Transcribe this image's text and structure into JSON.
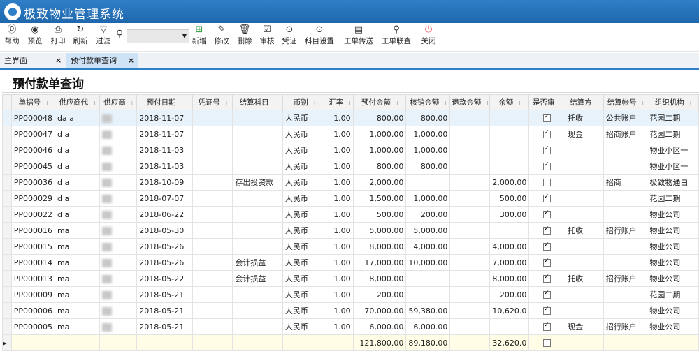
{
  "app": {
    "title": "极致物业管理系统"
  },
  "toolbar": {
    "help": "帮助",
    "preview": "预览",
    "print": "打印",
    "refresh": "刷新",
    "filter": "过滤",
    "add": "新增",
    "edit": "修改",
    "delete": "删除",
    "audit": "审核",
    "voucher": "凭证",
    "subject_setting": "科目设置",
    "workflow_transfer": "工单传送",
    "workflow_query": "工单联查",
    "close": "关闭"
  },
  "tabs": [
    {
      "label": "主界面"
    },
    {
      "label": "预付款单查询"
    }
  ],
  "panel": {
    "title": "预付款单查询"
  },
  "columns": [
    "单据号",
    "供应商代",
    "供应商",
    "预付日期",
    "凭证号",
    "结算科目",
    "币别",
    "汇率",
    "预付金额",
    "核销金额",
    "退款金额",
    "余额",
    "是否审",
    "结算方",
    "结算帐号",
    "组织机构"
  ],
  "rows": [
    {
      "no": "PP000048",
      "code": "da  a",
      "date": "2018-11-07",
      "voucher": "",
      "subject": "",
      "currency": "人民币",
      "rate": "1.00",
      "amount": "800.00",
      "verified": "800.00",
      "refund": "",
      "balance": "",
      "audited": true,
      "method": "托收",
      "account": "公共账户",
      "org": "花园二期"
    },
    {
      "no": "PP000047",
      "code": "d  a",
      "date": "2018-11-07",
      "voucher": "",
      "subject": "",
      "currency": "人民币",
      "rate": "1.00",
      "amount": "1,000.00",
      "verified": "1,000.00",
      "refund": "",
      "balance": "",
      "audited": true,
      "method": "现金",
      "account": "招商账户",
      "org": "花园二期"
    },
    {
      "no": "PP000046",
      "code": "d  a",
      "date": "2018-11-03",
      "voucher": "",
      "subject": "",
      "currency": "人民币",
      "rate": "1.00",
      "amount": "1,000.00",
      "verified": "1,000.00",
      "refund": "",
      "balance": "",
      "audited": true,
      "method": "",
      "account": "",
      "org": "物业小区一"
    },
    {
      "no": "PP000045",
      "code": "d  a",
      "date": "2018-11-03",
      "voucher": "",
      "subject": "",
      "currency": "人民币",
      "rate": "1.00",
      "amount": "800.00",
      "verified": "800.00",
      "refund": "",
      "balance": "",
      "audited": true,
      "method": "",
      "account": "",
      "org": "物业小区一"
    },
    {
      "no": "PP000036",
      "code": "d  a",
      "date": "2018-10-09",
      "voucher": "",
      "subject": "存出投资款",
      "currency": "人民币",
      "rate": "1.00",
      "amount": "2,000.00",
      "verified": "",
      "refund": "",
      "balance": "2,000.00",
      "audited": false,
      "method": "",
      "account": "招商",
      "org": "极致物通白"
    },
    {
      "no": "PP000029",
      "code": "d  a",
      "date": "2018-07-07",
      "voucher": "",
      "subject": "",
      "currency": "人民币",
      "rate": "1.00",
      "amount": "1,500.00",
      "verified": "1,000.00",
      "refund": "",
      "balance": "500.00",
      "audited": true,
      "method": "",
      "account": "",
      "org": "花园二期"
    },
    {
      "no": "PP000022",
      "code": "d  a",
      "date": "2018-06-22",
      "voucher": "",
      "subject": "",
      "currency": "人民币",
      "rate": "1.00",
      "amount": "500.00",
      "verified": "200.00",
      "refund": "",
      "balance": "300.00",
      "audited": true,
      "method": "",
      "account": "",
      "org": "物业公司"
    },
    {
      "no": "PP000016",
      "code": "ma",
      "date": "2018-05-30",
      "voucher": "",
      "subject": "",
      "currency": "人民币",
      "rate": "1.00",
      "amount": "5,000.00",
      "verified": "5,000.00",
      "refund": "",
      "balance": "",
      "audited": true,
      "method": "托收",
      "account": "招行账户",
      "org": "物业公司"
    },
    {
      "no": "PP000015",
      "code": "ma",
      "date": "2018-05-26",
      "voucher": "",
      "subject": "",
      "currency": "人民币",
      "rate": "1.00",
      "amount": "8,000.00",
      "verified": "4,000.00",
      "refund": "",
      "balance": "4,000.00",
      "audited": true,
      "method": "",
      "account": "",
      "org": "物业公司"
    },
    {
      "no": "PP000014",
      "code": "ma",
      "date": "2018-05-26",
      "voucher": "",
      "subject": "会计损益",
      "currency": "人民币",
      "rate": "1.00",
      "amount": "17,000.00",
      "verified": "10,000.00",
      "refund": "",
      "balance": "7,000.00",
      "audited": true,
      "method": "",
      "account": "",
      "org": "物业公司"
    },
    {
      "no": "PP000013",
      "code": "ma",
      "date": "2018-05-22",
      "voucher": "",
      "subject": "会计损益",
      "currency": "人民币",
      "rate": "1.00",
      "amount": "8,000.00",
      "verified": "",
      "refund": "",
      "balance": "8,000.00",
      "audited": true,
      "method": "托收",
      "account": "招行账户",
      "org": "物业公司"
    },
    {
      "no": "PP000009",
      "code": "ma",
      "date": "2018-05-21",
      "voucher": "",
      "subject": "",
      "currency": "人民币",
      "rate": "1.00",
      "amount": "200.00",
      "verified": "",
      "refund": "",
      "balance": "200.00",
      "audited": true,
      "method": "",
      "account": "",
      "org": "花园二期"
    },
    {
      "no": "PP000006",
      "code": "ma",
      "date": "2018-05-21",
      "voucher": "",
      "subject": "",
      "currency": "人民币",
      "rate": "1.00",
      "amount": "70,000.00",
      "verified": "59,380.00",
      "refund": "",
      "balance": "10,620.0",
      "audited": true,
      "method": "",
      "account": "",
      "org": "物业公司"
    },
    {
      "no": "PP000005",
      "code": "ma",
      "date": "2018-05-21",
      "voucher": "",
      "subject": "",
      "currency": "人民币",
      "rate": "1.00",
      "amount": "6,000.00",
      "verified": "6,000.00",
      "refund": "",
      "balance": "",
      "audited": true,
      "method": "现金",
      "account": "招行账户",
      "org": "物业公司"
    }
  ],
  "totals": {
    "amount": "121,800.00",
    "verified": "89,180.00",
    "balance": "32,620.0"
  }
}
